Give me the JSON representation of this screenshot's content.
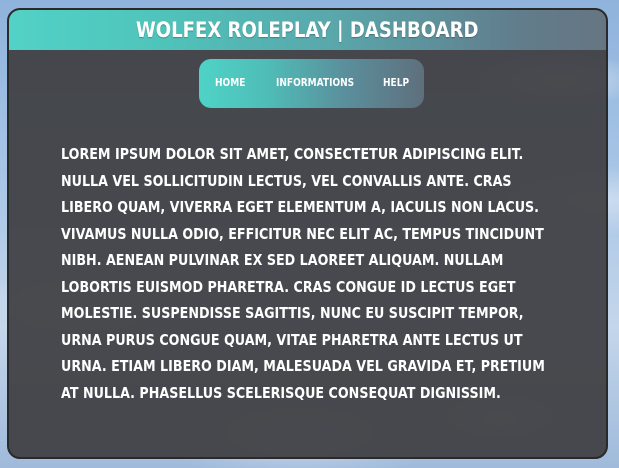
{
  "header": {
    "title": "WOLFEX ROLEPLAY | DASHBOARD"
  },
  "nav": {
    "items": [
      {
        "label": "HOME"
      },
      {
        "label": "INFORMATIONS"
      },
      {
        "label": "HELP"
      }
    ]
  },
  "main": {
    "body_text": "Lorem ipsum dolor sit amet, consectetur adipiscing elit. Nulla vel sollicitudin lectus, vel convallis ante. Cras libero quam, viverra eget elementum a, iaculis non lacus. Vivamus nulla odio, efficitur nec elit ac, tempus tincidunt nibh. Aenean pulvinar ex sed laoreet aliquam. Nullam lobortis euismod pharetra. Cras congue id lectus eget molestie. Suspendisse sagittis, nunc eu suscipit tempor, urna purus congue quam, vitae pharetra ante lectus ut urna. Etiam libero diam, malesuada vel gravida et, pretium at nulla. Phasellus scelerisque consequat dignissim."
  },
  "colors": {
    "accent_start": "#52d2c6",
    "accent_end": "#667582",
    "panel_bg": "#3e3e42",
    "text": "#ffffff"
  }
}
